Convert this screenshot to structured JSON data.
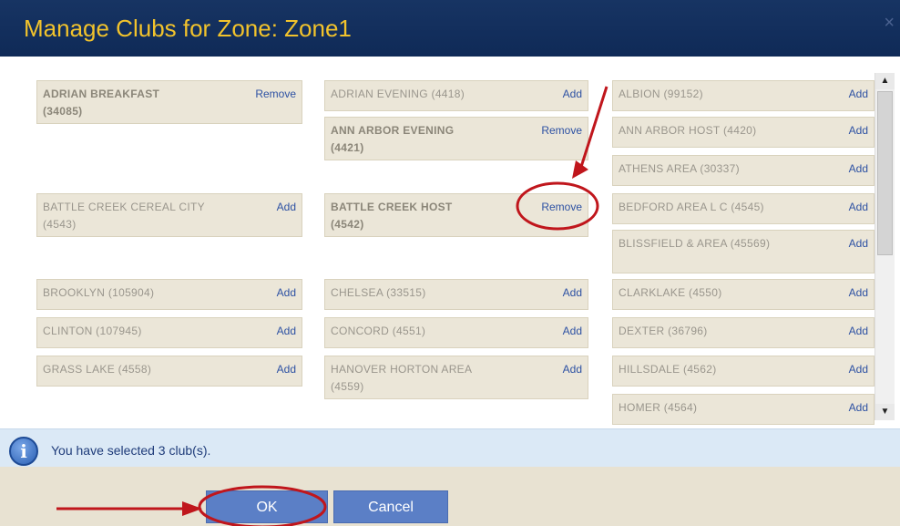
{
  "dialog": {
    "title": "Manage Clubs for Zone: Zone1",
    "close_glyph": "×"
  },
  "labels": {
    "add": "Add",
    "remove": "Remove"
  },
  "columns": [
    {
      "clubs": [
        {
          "name": "ADRIAN BREAKFAST (34085)",
          "action": "Remove",
          "selected": true
        },
        {
          "name": "BATTLE CREEK CEREAL CITY (4543)",
          "action": "Add",
          "selected": false
        },
        {
          "name": "BROOKLYN (105904)",
          "action": "Add",
          "selected": false
        },
        {
          "name": "CLINTON (107945)",
          "action": "Add",
          "selected": false
        },
        {
          "name": "GRASS LAKE (4558)",
          "action": "Add",
          "selected": false
        }
      ]
    },
    {
      "clubs": [
        {
          "name": "ADRIAN EVENING (4418)",
          "action": "Add",
          "selected": false
        },
        {
          "name": "ANN ARBOR EVENING (4421)",
          "action": "Remove",
          "selected": true
        },
        {
          "name": "BATTLE CREEK HOST (4542)",
          "action": "Remove",
          "selected": true
        },
        {
          "name": "CHELSEA (33515)",
          "action": "Add",
          "selected": false
        },
        {
          "name": "CONCORD (4551)",
          "action": "Add",
          "selected": false
        },
        {
          "name": "HANOVER HORTON AREA (4559)",
          "action": "Add",
          "selected": false
        }
      ]
    },
    {
      "clubs": [
        {
          "name": "ALBION (99152)",
          "action": "Add",
          "selected": false
        },
        {
          "name": "ANN ARBOR HOST (4420)",
          "action": "Add",
          "selected": false
        },
        {
          "name": "ATHENS AREA (30337)",
          "action": "Add",
          "selected": false
        },
        {
          "name": "BEDFORD AREA L C (4545)",
          "action": "Add",
          "selected": false
        },
        {
          "name": "BLISSFIELD & AREA (45569)",
          "action": "Add",
          "selected": false
        },
        {
          "name": "CLARKLAKE (4550)",
          "action": "Add",
          "selected": false
        },
        {
          "name": "DEXTER (36796)",
          "action": "Add",
          "selected": false
        },
        {
          "name": "HILLSDALE (4562)",
          "action": "Add",
          "selected": false
        },
        {
          "name": "HOMER (4564)",
          "action": "Add",
          "selected": false
        }
      ]
    }
  ],
  "info": {
    "icon": "info-icon",
    "message": "You have selected  3 club(s)."
  },
  "buttons": {
    "ok": "OK",
    "cancel": "Cancel"
  },
  "colors": {
    "title_bg": "#173463",
    "title_text": "#f2c32c",
    "annotation_red": "#c0161c",
    "link_blue": "#2d51a3",
    "button_blue": "#5b7fc6"
  }
}
